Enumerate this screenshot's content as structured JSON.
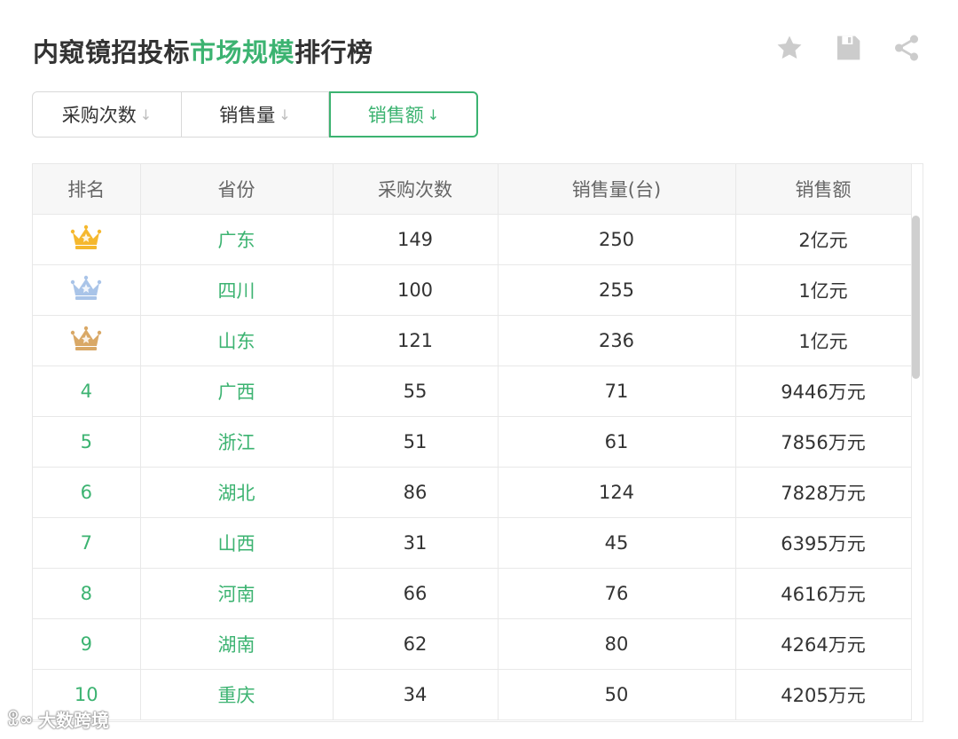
{
  "header": {
    "title_prefix": "内窥镜招投标",
    "title_highlight": "市场规模",
    "title_suffix": "排行榜"
  },
  "toolbar": {
    "icons": [
      "star-icon",
      "save-icon",
      "share-icon"
    ],
    "icon_color": "#cccccc"
  },
  "tabs": [
    {
      "label": "采购次数",
      "arrow": "↓"
    },
    {
      "label": "销售量",
      "arrow": "↓"
    },
    {
      "label": "销售额",
      "arrow": "↓",
      "active": true
    }
  ],
  "table": {
    "headers": [
      "排名",
      "省份",
      "采购次数",
      "销售量(台)",
      "销售额"
    ],
    "rows": [
      {
        "rank": "",
        "crown": "gold",
        "province": "广东",
        "count": "149",
        "units": "250",
        "amount": "2亿元"
      },
      {
        "rank": "",
        "crown": "silver",
        "province": "四川",
        "count": "100",
        "units": "255",
        "amount": "1亿元"
      },
      {
        "rank": "",
        "crown": "bronze",
        "province": "山东",
        "count": "121",
        "units": "236",
        "amount": "1亿元"
      },
      {
        "rank": "4",
        "province": "广西",
        "count": "55",
        "units": "71",
        "amount": "9446万元"
      },
      {
        "rank": "5",
        "province": "浙江",
        "count": "51",
        "units": "61",
        "amount": "7856万元"
      },
      {
        "rank": "6",
        "province": "湖北",
        "count": "86",
        "units": "124",
        "amount": "7828万元"
      },
      {
        "rank": "7",
        "province": "山西",
        "count": "31",
        "units": "45",
        "amount": "6395万元"
      },
      {
        "rank": "8",
        "province": "河南",
        "count": "66",
        "units": "76",
        "amount": "4616万元"
      },
      {
        "rank": "9",
        "province": "湖南",
        "count": "62",
        "units": "80",
        "amount": "4264万元"
      },
      {
        "rank": "10",
        "province": "重庆",
        "count": "34",
        "units": "50",
        "amount": "4205万元"
      }
    ]
  },
  "colors": {
    "accent": "#3cb371",
    "text": "#333333",
    "header_bg": "#f7f7f7",
    "crown_gold": "#f5b82e",
    "crown_silver": "#a9c4e8",
    "crown_bronze": "#d9a866"
  },
  "watermark": {
    "text": "大数跨境"
  }
}
